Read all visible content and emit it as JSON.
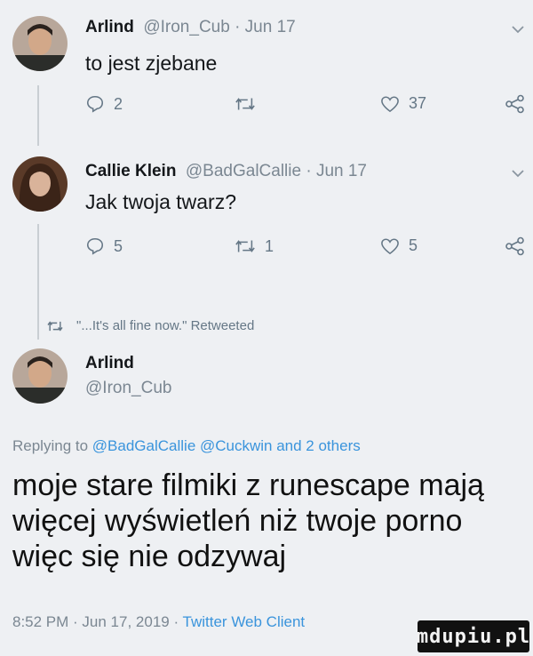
{
  "reply_1": {
    "name": "Arlind",
    "meta": "@Iron_Cub · Jun 17",
    "text": "to jest zjebane",
    "replies": "2",
    "retweets": "",
    "likes": "37"
  },
  "reply_2": {
    "name": "Callie Klein",
    "meta": "@BadGalCallie · Jun 17",
    "text": "Jak twoja twarz?",
    "replies": "5",
    "retweets": "1",
    "likes": "5"
  },
  "retweet_banner": "\"...It's all fine now.\" Retweeted",
  "main_tweet": {
    "name": "Arlind",
    "handle": "@Iron_Cub",
    "replying_prefix": "Replying to",
    "mentions": "@BadGalCallie @Cuckwin and 2 others",
    "lines": [
      "moje stare filmiki z runescape mają",
      "więcej wyświetleń niż twoje porno",
      "więc się nie odzywaj"
    ],
    "footer_time": "8:52 PM · Jun 17, 2019 · ",
    "footer_client": "Twitter Web Client"
  },
  "watermark": "mdupiu.pl",
  "icons": [
    "reply-icon",
    "retweet-icon",
    "like-icon",
    "share-icon",
    "chevron-down-icon"
  ],
  "colors": {
    "link": "#3a94dc",
    "muted": "#7b8792",
    "background": "#eef0f3"
  }
}
